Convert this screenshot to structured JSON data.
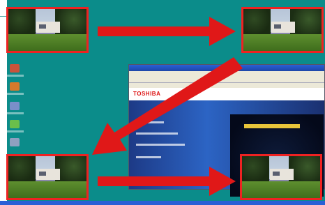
{
  "scene": {
    "description_labels": [],
    "desktop_background": "#0b8c8a",
    "highlight_color": "#e22222",
    "arrow_color": "#e01818"
  },
  "browser": {
    "logo_text": "TOSHIBA"
  },
  "thumbnails": [
    {
      "id": "top-left"
    },
    {
      "id": "top-right"
    },
    {
      "id": "bottom-left"
    },
    {
      "id": "bottom-right"
    }
  ],
  "icons": [
    "recycle-bin-icon",
    "document-icon",
    "computer-icon",
    "network-icon",
    "folder-icon"
  ]
}
